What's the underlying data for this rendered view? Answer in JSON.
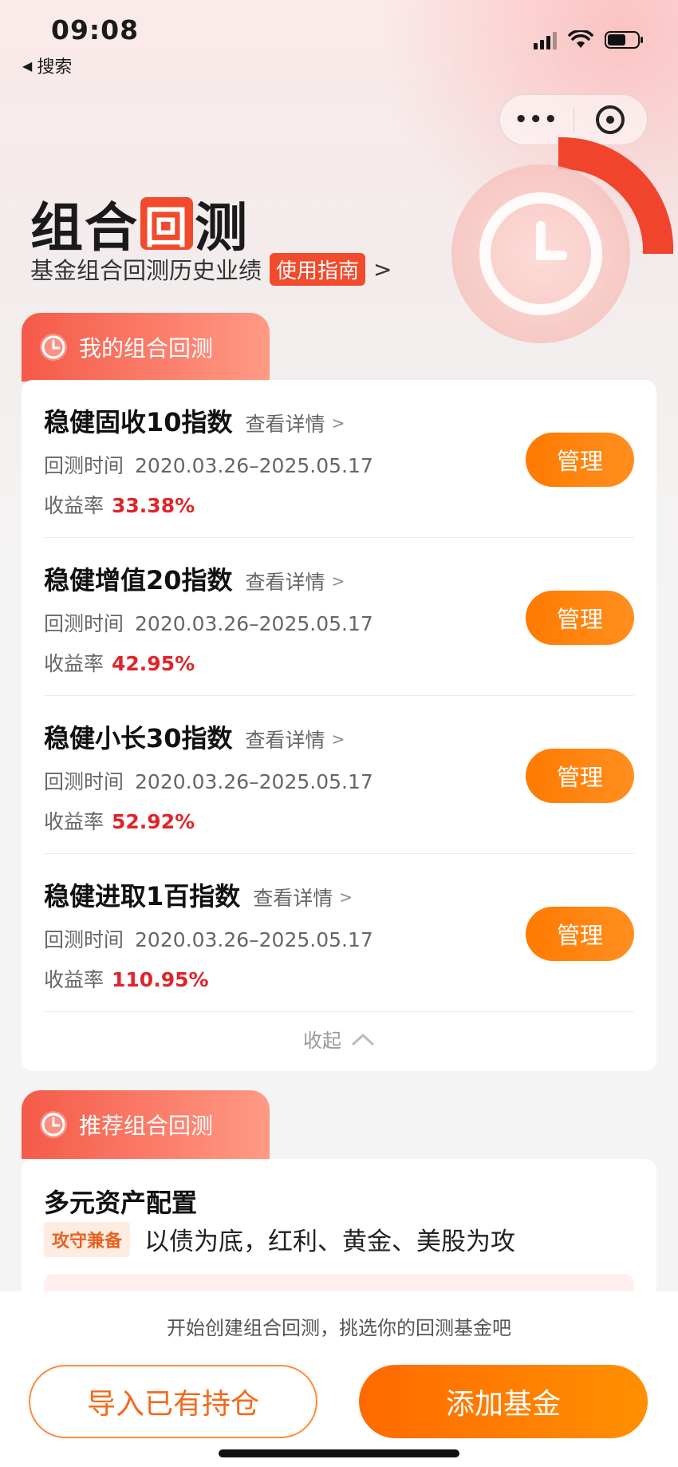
{
  "status_bar": {
    "time": "09:08",
    "back_label": "搜索"
  },
  "capsule": {
    "more_icon": "more-icon",
    "close_icon": "close-circle-icon"
  },
  "hero": {
    "title_part1": "组合",
    "title_box_char": "回",
    "title_part2": "测",
    "subtitle": "基金组合回测历史业绩",
    "guide_label": "使用指南",
    "guide_arrow": ">"
  },
  "my_section": {
    "tab_label": "我的组合回测",
    "items": [
      {
        "name": "稳健固收10指数",
        "detail_label": "查看详情",
        "period_label": "回测时间",
        "period_value": "2020.03.26–2025.05.17",
        "yield_label": "收益率",
        "yield_value": "33.38%",
        "manage_label": "管理"
      },
      {
        "name": "稳健增值20指数",
        "detail_label": "查看详情",
        "period_label": "回测时间",
        "period_value": "2020.03.26–2025.05.17",
        "yield_label": "收益率",
        "yield_value": "42.95%",
        "manage_label": "管理"
      },
      {
        "name": "稳健小长30指数",
        "detail_label": "查看详情",
        "period_label": "回测时间",
        "period_value": "2020.03.26–2025.05.17",
        "yield_label": "收益率",
        "yield_value": "52.92%",
        "manage_label": "管理"
      },
      {
        "name": "稳健进取1百指数",
        "detail_label": "查看详情",
        "period_label": "回测时间",
        "period_value": "2020.03.26–2025.05.17",
        "yield_label": "收益率",
        "yield_value": "110.95%",
        "manage_label": "管理"
      }
    ],
    "collapse_label": "收起"
  },
  "rec_section": {
    "tab_label": "推荐组合回测",
    "name": "多元资产配置",
    "tag": "攻守兼备",
    "description": "以债为底，红利、黄金、美股为攻"
  },
  "bottom": {
    "hint": "开始创建组合回测，挑选你的回测基金吧",
    "import_label": "导入已有持仓",
    "add_label": "添加基金"
  },
  "colors": {
    "accent_red": "#f24a2c",
    "accent_orange": "#ff7a00",
    "yield_red": "#e0242a"
  }
}
